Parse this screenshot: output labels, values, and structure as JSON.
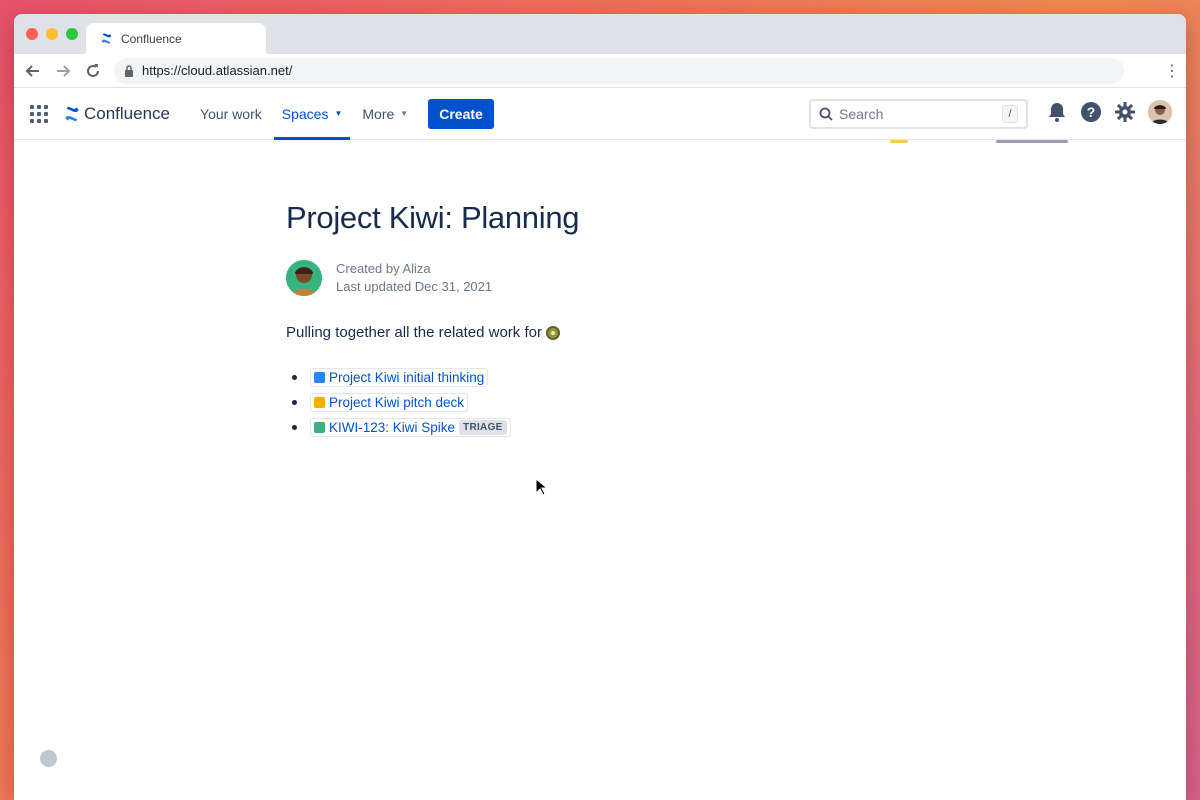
{
  "browser": {
    "tab_title": "Confluence",
    "url": "https://cloud.atlassian.net/"
  },
  "appbar": {
    "logo_text": "Confluence",
    "nav": [
      {
        "label": "Your work"
      },
      {
        "label": "Spaces"
      },
      {
        "label": "More"
      }
    ],
    "create_label": "Create",
    "search_placeholder": "Search",
    "search_shortcut": "/"
  },
  "page": {
    "title": "Project Kiwi: Planning",
    "created_by": "Created by Aliza",
    "last_updated": "Last updated Dec 31, 2021",
    "intro": "Pulling together all the related work for",
    "links": [
      {
        "label": "Project Kiwi initial thinking",
        "icon": "document-icon"
      },
      {
        "label": "Project Kiwi pitch deck",
        "icon": "slides-icon"
      },
      {
        "label": "KIWI-123: Kiwi Spike",
        "icon": "jira-issue-icon",
        "status": "TRIAGE"
      }
    ]
  },
  "colors": {
    "brand": "#0052cc",
    "text": "#172b4d"
  }
}
